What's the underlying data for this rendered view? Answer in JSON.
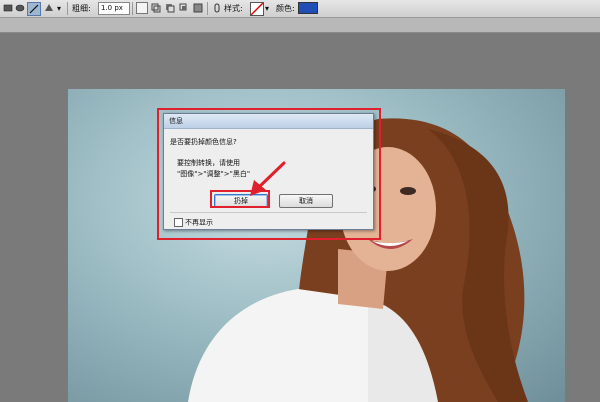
{
  "option_bar": {
    "tool_icons": [
      "rectangle-shape-icon",
      "ellipse-shape-icon",
      "line-shape-icon",
      "custom-shape-icon"
    ],
    "weight_label": "粗细:",
    "weight_value": "1.0 px",
    "style_label": "样式:",
    "color_label": "颜色:",
    "color_swatch": "#1f4fb5"
  },
  "dialog": {
    "title": "信息",
    "question": "是否要扔掉颜色信息?",
    "message_line1": "要控制转换，请使用",
    "message_line2": "\"图像\">\"调整\">\"黑白\"",
    "discard_button": "扔掉",
    "cancel_button": "取消",
    "dont_show_label": "不再显示"
  },
  "colors": {
    "highlight": "#e0202c",
    "arrow": "#e0202c"
  }
}
